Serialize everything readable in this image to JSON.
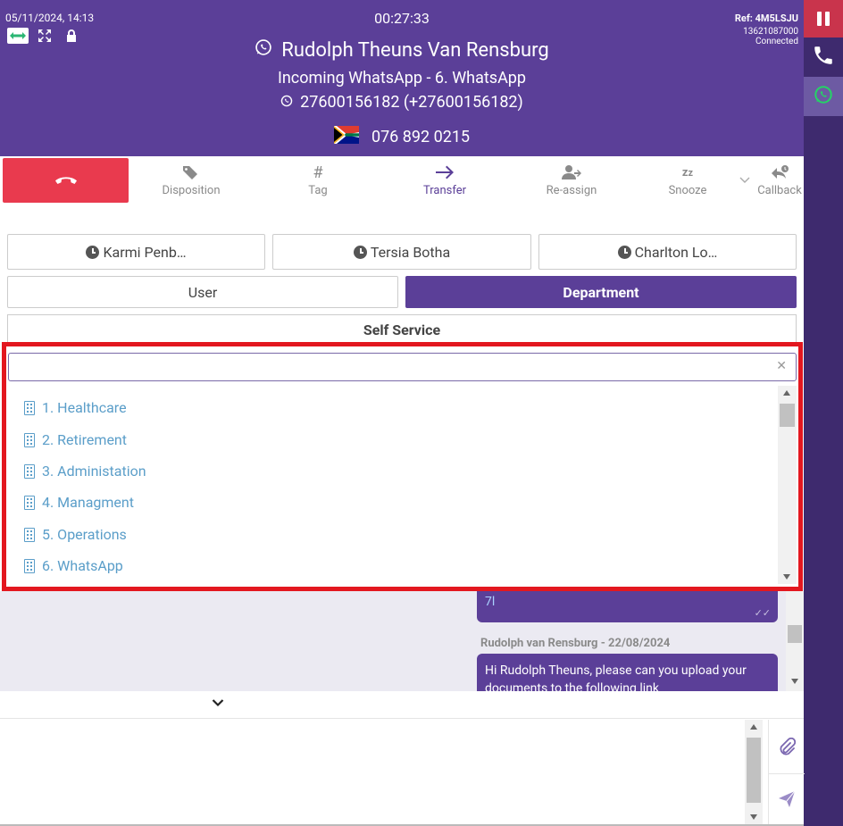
{
  "header": {
    "datetime": "05/11/2024, 14:13",
    "timer": "00:27:33",
    "ref": "Ref: 4M5LSJU",
    "account_id": "13621087000",
    "status": "Connected",
    "contact_name": "Rudolph Theuns Van Rensburg",
    "incoming_label": "Incoming WhatsApp - 6. WhatsApp",
    "whatsapp_number": "27600156182 (+27600156182)",
    "local_number": "076 892 0215"
  },
  "actions": {
    "disposition": "Disposition",
    "tag": "Tag",
    "transfer": "Transfer",
    "reassign": "Re-assign",
    "snooze": "Snooze",
    "callback": "Callback"
  },
  "recent_agents": [
    "Karmi Penb…",
    "Tersia Botha",
    "Charlton Lo…"
  ],
  "transfer_tabs": {
    "user": "User",
    "department": "Department",
    "self_service": "Self Service"
  },
  "search": {
    "value": "",
    "placeholder": ""
  },
  "departments": [
    "1. Healthcare",
    "2. Retirement",
    "3. Administation",
    "4. Managment",
    "5. Operations",
    "6. WhatsApp"
  ],
  "chat": {
    "bubble1_link": "7l",
    "sender": "Rudolph van Rensburg - 22/08/2024",
    "bubble2_text": "Hi Rudolph Theuns, please can you upload your documents to the following link"
  },
  "colors": {
    "brand": "#5b3f98",
    "hangup": "#e93a4e",
    "highlight": "#e3171f",
    "link": "#5b9ec9"
  }
}
